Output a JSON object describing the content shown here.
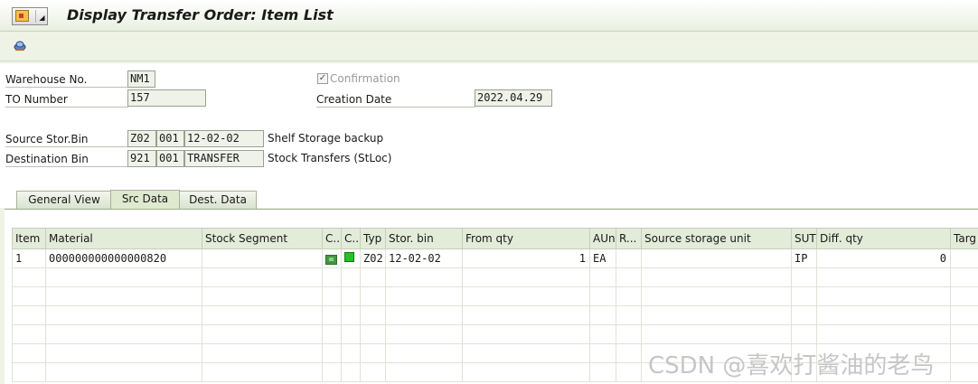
{
  "window": {
    "title": "Display Transfer Order: Item List"
  },
  "header": {
    "warehouse_label": "Warehouse No.",
    "warehouse_value": "NM1",
    "to_number_label": "TO Number",
    "to_number_value": "157",
    "confirmation_label": "Confirmation",
    "confirmation_checked": "✓",
    "creation_date_label": "Creation Date",
    "creation_date_value": "2022.04.29",
    "source_bin_label": "Source Stor.Bin",
    "source_type": "Z02",
    "source_section": "001",
    "source_bin": "12-02-02",
    "source_desc": "Shelf Storage backup",
    "dest_bin_label": "Destination Bin",
    "dest_type": "921",
    "dest_section": "001",
    "dest_bin": "TRANSFER",
    "dest_desc": "Stock Transfers (StLoc)"
  },
  "tabs": [
    {
      "label": "General View"
    },
    {
      "label": "Src Data"
    },
    {
      "label": "Dest. Data"
    }
  ],
  "table": {
    "columns": [
      "Item",
      "Material",
      "Stock Segment",
      "C..",
      "C..",
      "Typ",
      "Stor. bin",
      "From qty",
      "AUn",
      "R...",
      "Source storage unit",
      "SUT",
      "Diff. qty",
      "Targ"
    ],
    "row": {
      "item": "1",
      "material": "000000000000000820",
      "stock_segment": "",
      "indicator1": "=",
      "typ": "Z02",
      "stor_bin": "12-02-02",
      "from_qty": "1",
      "aun": "EA",
      "r": "",
      "source_storage_unit": "",
      "sut": "IP",
      "diff_qty": "0"
    }
  },
  "watermark": "CSDN @喜欢打酱油的老鸟",
  "colors": {
    "background": "#eef3e6",
    "indicator_green": "#22c323"
  }
}
